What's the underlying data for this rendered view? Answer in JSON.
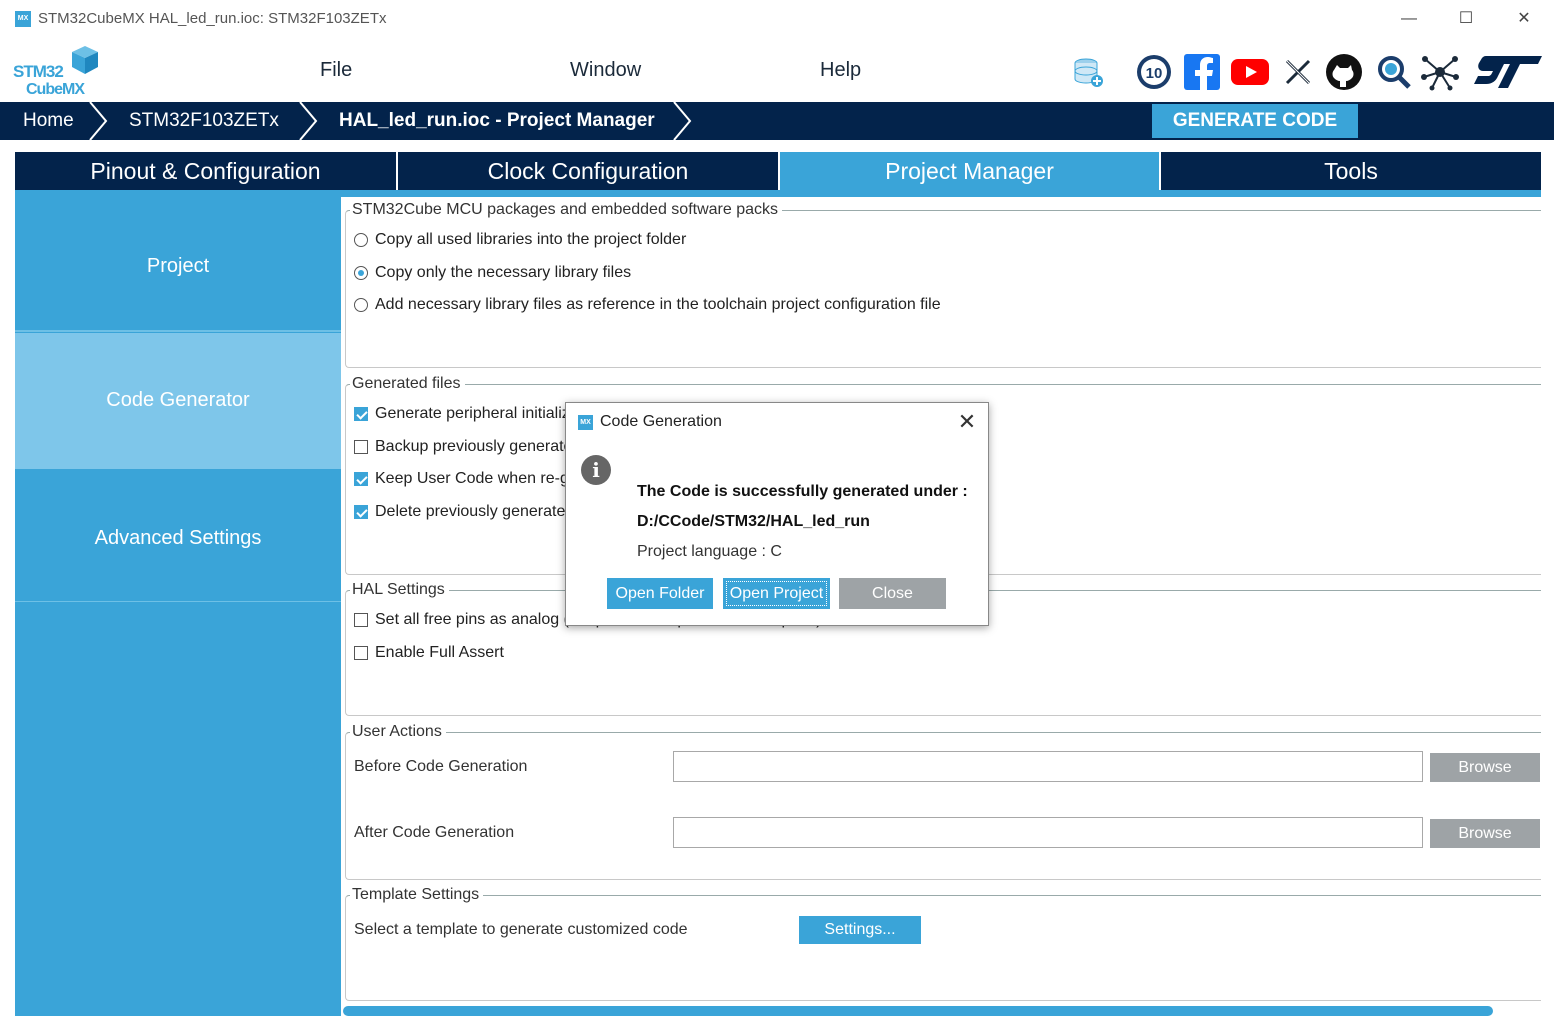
{
  "window": {
    "title": "STM32CubeMX HAL_led_run.ioc: STM32F103ZETx",
    "app_badge": "MX",
    "minimize": "—",
    "maximize": "☐",
    "close": "✕"
  },
  "logo": {
    "line1": "STM32",
    "line2": "CubeMX"
  },
  "menu": [
    "File",
    "Window",
    "Help"
  ],
  "header_icons": [
    "database-icon",
    "anniversary-badge-icon",
    "facebook-icon",
    "youtube-icon",
    "x-icon",
    "github-icon",
    "search-icon",
    "network-icon",
    "st-logo-icon"
  ],
  "badge_text": "10",
  "breadcrumb": [
    "Home",
    "STM32F103ZETx",
    "HAL_led_run.ioc - Project Manager"
  ],
  "generate_button": "GENERATE CODE",
  "tabs": [
    "Pinout & Configuration",
    "Clock Configuration",
    "Project Manager",
    "Tools"
  ],
  "active_tab": "Project Manager",
  "sidebar": [
    "Project",
    "Code Generator",
    "Advanced Settings"
  ],
  "active_sidebar": "Code Generator",
  "packages_group": {
    "title": "STM32Cube MCU packages and embedded software packs",
    "options": [
      {
        "label": "Copy all used libraries into the project folder",
        "selected": false
      },
      {
        "label": "Copy only the necessary library files",
        "selected": true
      },
      {
        "label": "Add necessary library files as reference in the toolchain project configuration file",
        "selected": false
      }
    ]
  },
  "generated_files": {
    "title": "Generated files",
    "options": [
      {
        "label": "Generate peripheral initializ",
        "checked": true
      },
      {
        "label": "Backup previously generate",
        "checked": false
      },
      {
        "label": "Keep User Code when re-g",
        "checked": true
      },
      {
        "label": "Delete previously generated",
        "checked": true
      }
    ]
  },
  "hal_settings": {
    "title": "HAL Settings",
    "options": [
      {
        "label": "Set all free pins as analog (to optimize the power consumption)",
        "checked": false
      },
      {
        "label": "Enable Full Assert",
        "checked": false
      }
    ]
  },
  "user_actions": {
    "title": "User Actions",
    "before_label": "Before Code Generation",
    "before_value": "",
    "after_label": "After Code Generation",
    "after_value": "",
    "browse": "Browse"
  },
  "template_settings": {
    "title": "Template Settings",
    "label": "Select a template to generate customized code",
    "button": "Settings..."
  },
  "dialog": {
    "title": "Code Generation",
    "message": "The Code is successfully generated under :",
    "path": "D:/CCode/STM32/HAL_led_run",
    "language": "Project language : C",
    "buttons": [
      "Open Folder",
      "Open Project",
      "Close"
    ],
    "close_glyph": "✕",
    "info_glyph": "i"
  },
  "colors": {
    "accent": "#3aa4d8",
    "navy": "#03234b",
    "button_gray": "#9ea3a6"
  }
}
